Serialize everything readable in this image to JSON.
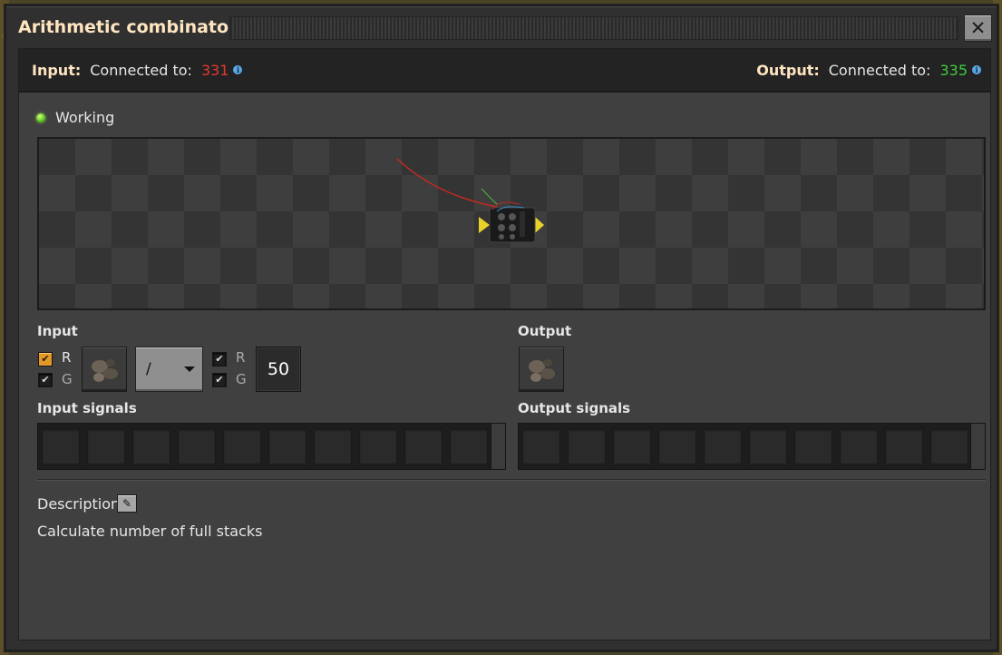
{
  "window": {
    "title": "Arithmetic combinator",
    "close_label": "✕"
  },
  "connections": {
    "input_label": "Input:",
    "input_text": "Connected to:",
    "input_id": "331",
    "output_label": "Output:",
    "output_text": "Connected to:",
    "output_id": "335",
    "info_glyph": "i"
  },
  "status": {
    "text": "Working",
    "color": "#58c21a"
  },
  "input": {
    "heading": "Input",
    "left_red_label": "R",
    "left_green_label": "G",
    "left_red_checked": true,
    "left_green_checked": true,
    "left_signal_icon": "stone-icon",
    "operator": "/",
    "right_red_label": "R",
    "right_green_label": "G",
    "right_red_checked": true,
    "right_green_checked": true,
    "constant": "50"
  },
  "output": {
    "heading": "Output",
    "signal_icon": "stone-icon"
  },
  "signals": {
    "input_heading": "Input signals",
    "output_heading": "Output signals"
  },
  "description": {
    "heading": "Description",
    "text": "Calculate number of full stacks"
  },
  "colors": {
    "title": "#ffe6c0",
    "red_wire": "#e03a2e",
    "green_wire": "#3ecb3e",
    "checkbox_active": "#e39827"
  }
}
